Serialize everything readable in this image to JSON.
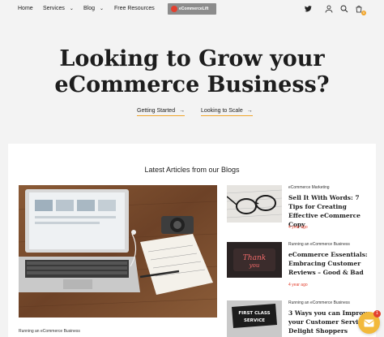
{
  "nav": {
    "items": [
      {
        "label": "Home"
      },
      {
        "label": "Services"
      },
      {
        "label": "Blog"
      },
      {
        "label": "Free Resources"
      }
    ],
    "logo_text": "eCommerceLift",
    "icons": [
      "twitter-icon",
      "user-icon",
      "search-icon",
      "cart-icon"
    ],
    "cart_count": "0"
  },
  "hero": {
    "title_line1": "Looking to Grow your",
    "title_line2": "eCommerce Business?",
    "links": [
      {
        "label": "Getting Started",
        "arrow": "→"
      },
      {
        "label": "Looking to Scale",
        "arrow": "→"
      }
    ]
  },
  "blog": {
    "section_title": "Latest Articles from our Blogs",
    "featured": {
      "category": "Running an eCommerce Business"
    },
    "articles": [
      {
        "category": "eCommerce Marketing",
        "title": "Sell It With Words: 7 Tips for Creating Effective eCommerce Copy",
        "date": "4 year ago"
      },
      {
        "category": "Running an eCommerce Business",
        "title": "eCommerce Essentials: Embracing Customer Reviews – Good & Bad",
        "date": "4 year ago"
      },
      {
        "category": "Running an eCommerce Business",
        "title": "3 Ways you can Improve your Customer Service: Delight Shoppers",
        "date": ""
      }
    ]
  },
  "chat": {
    "badge_count": "1"
  },
  "colors": {
    "accent": "#f0a52b",
    "date_red": "#e3402f",
    "chat_yellow": "#f2b93b"
  }
}
